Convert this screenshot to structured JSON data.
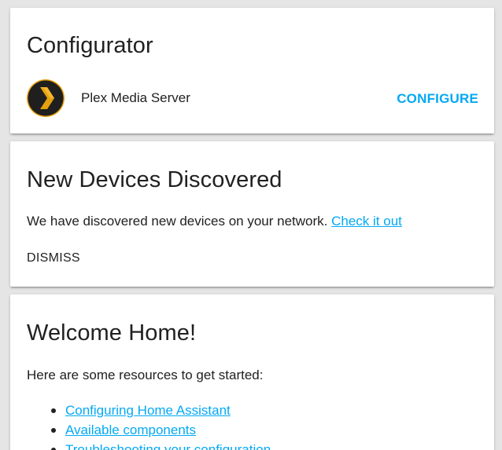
{
  "configurator": {
    "title": "Configurator",
    "item_name": "Plex Media Server",
    "configure_label": "CONFIGURE",
    "logo_icon": "plex-logo-icon"
  },
  "discovery": {
    "title": "New Devices Discovered",
    "text": "We have discovered new devices on your network.",
    "link_label": "Check it out",
    "dismiss_label": "DISMISS"
  },
  "welcome": {
    "title": "Welcome Home!",
    "text": "Here are some resources to get started:",
    "links": [
      "Configuring Home Assistant",
      "Available components",
      "Troubleshooting your configuration"
    ]
  },
  "colors": {
    "accent": "#03a9f4",
    "background": "#e5e5e5",
    "card": "#ffffff",
    "plex_orange": "#e5a00d"
  }
}
